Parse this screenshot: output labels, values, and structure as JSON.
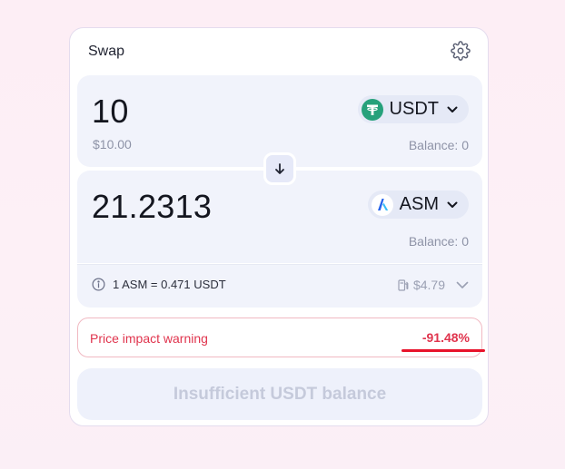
{
  "card": {
    "title": "Swap"
  },
  "from": {
    "amount": "10",
    "usd_value": "$10.00",
    "balance": "Balance: 0",
    "token": {
      "symbol": "USDT",
      "icon": "usdt-tether-icon",
      "color": "#26a17b"
    }
  },
  "to": {
    "amount": "21.2313",
    "balance": "Balance: 0",
    "token": {
      "symbol": "ASM",
      "icon": "asm-token-icon",
      "color": "#2563eb"
    }
  },
  "rate": {
    "text": "1 ASM = 0.471 USDT",
    "fee": "$4.79",
    "info_icon": "info-icon",
    "fee_icon": "gas-pump-icon"
  },
  "warning": {
    "label": "Price impact warning",
    "value": "-91.48%",
    "color": "#e0344d"
  },
  "action_button": {
    "label": "Insufficient USDT balance",
    "disabled": true
  }
}
